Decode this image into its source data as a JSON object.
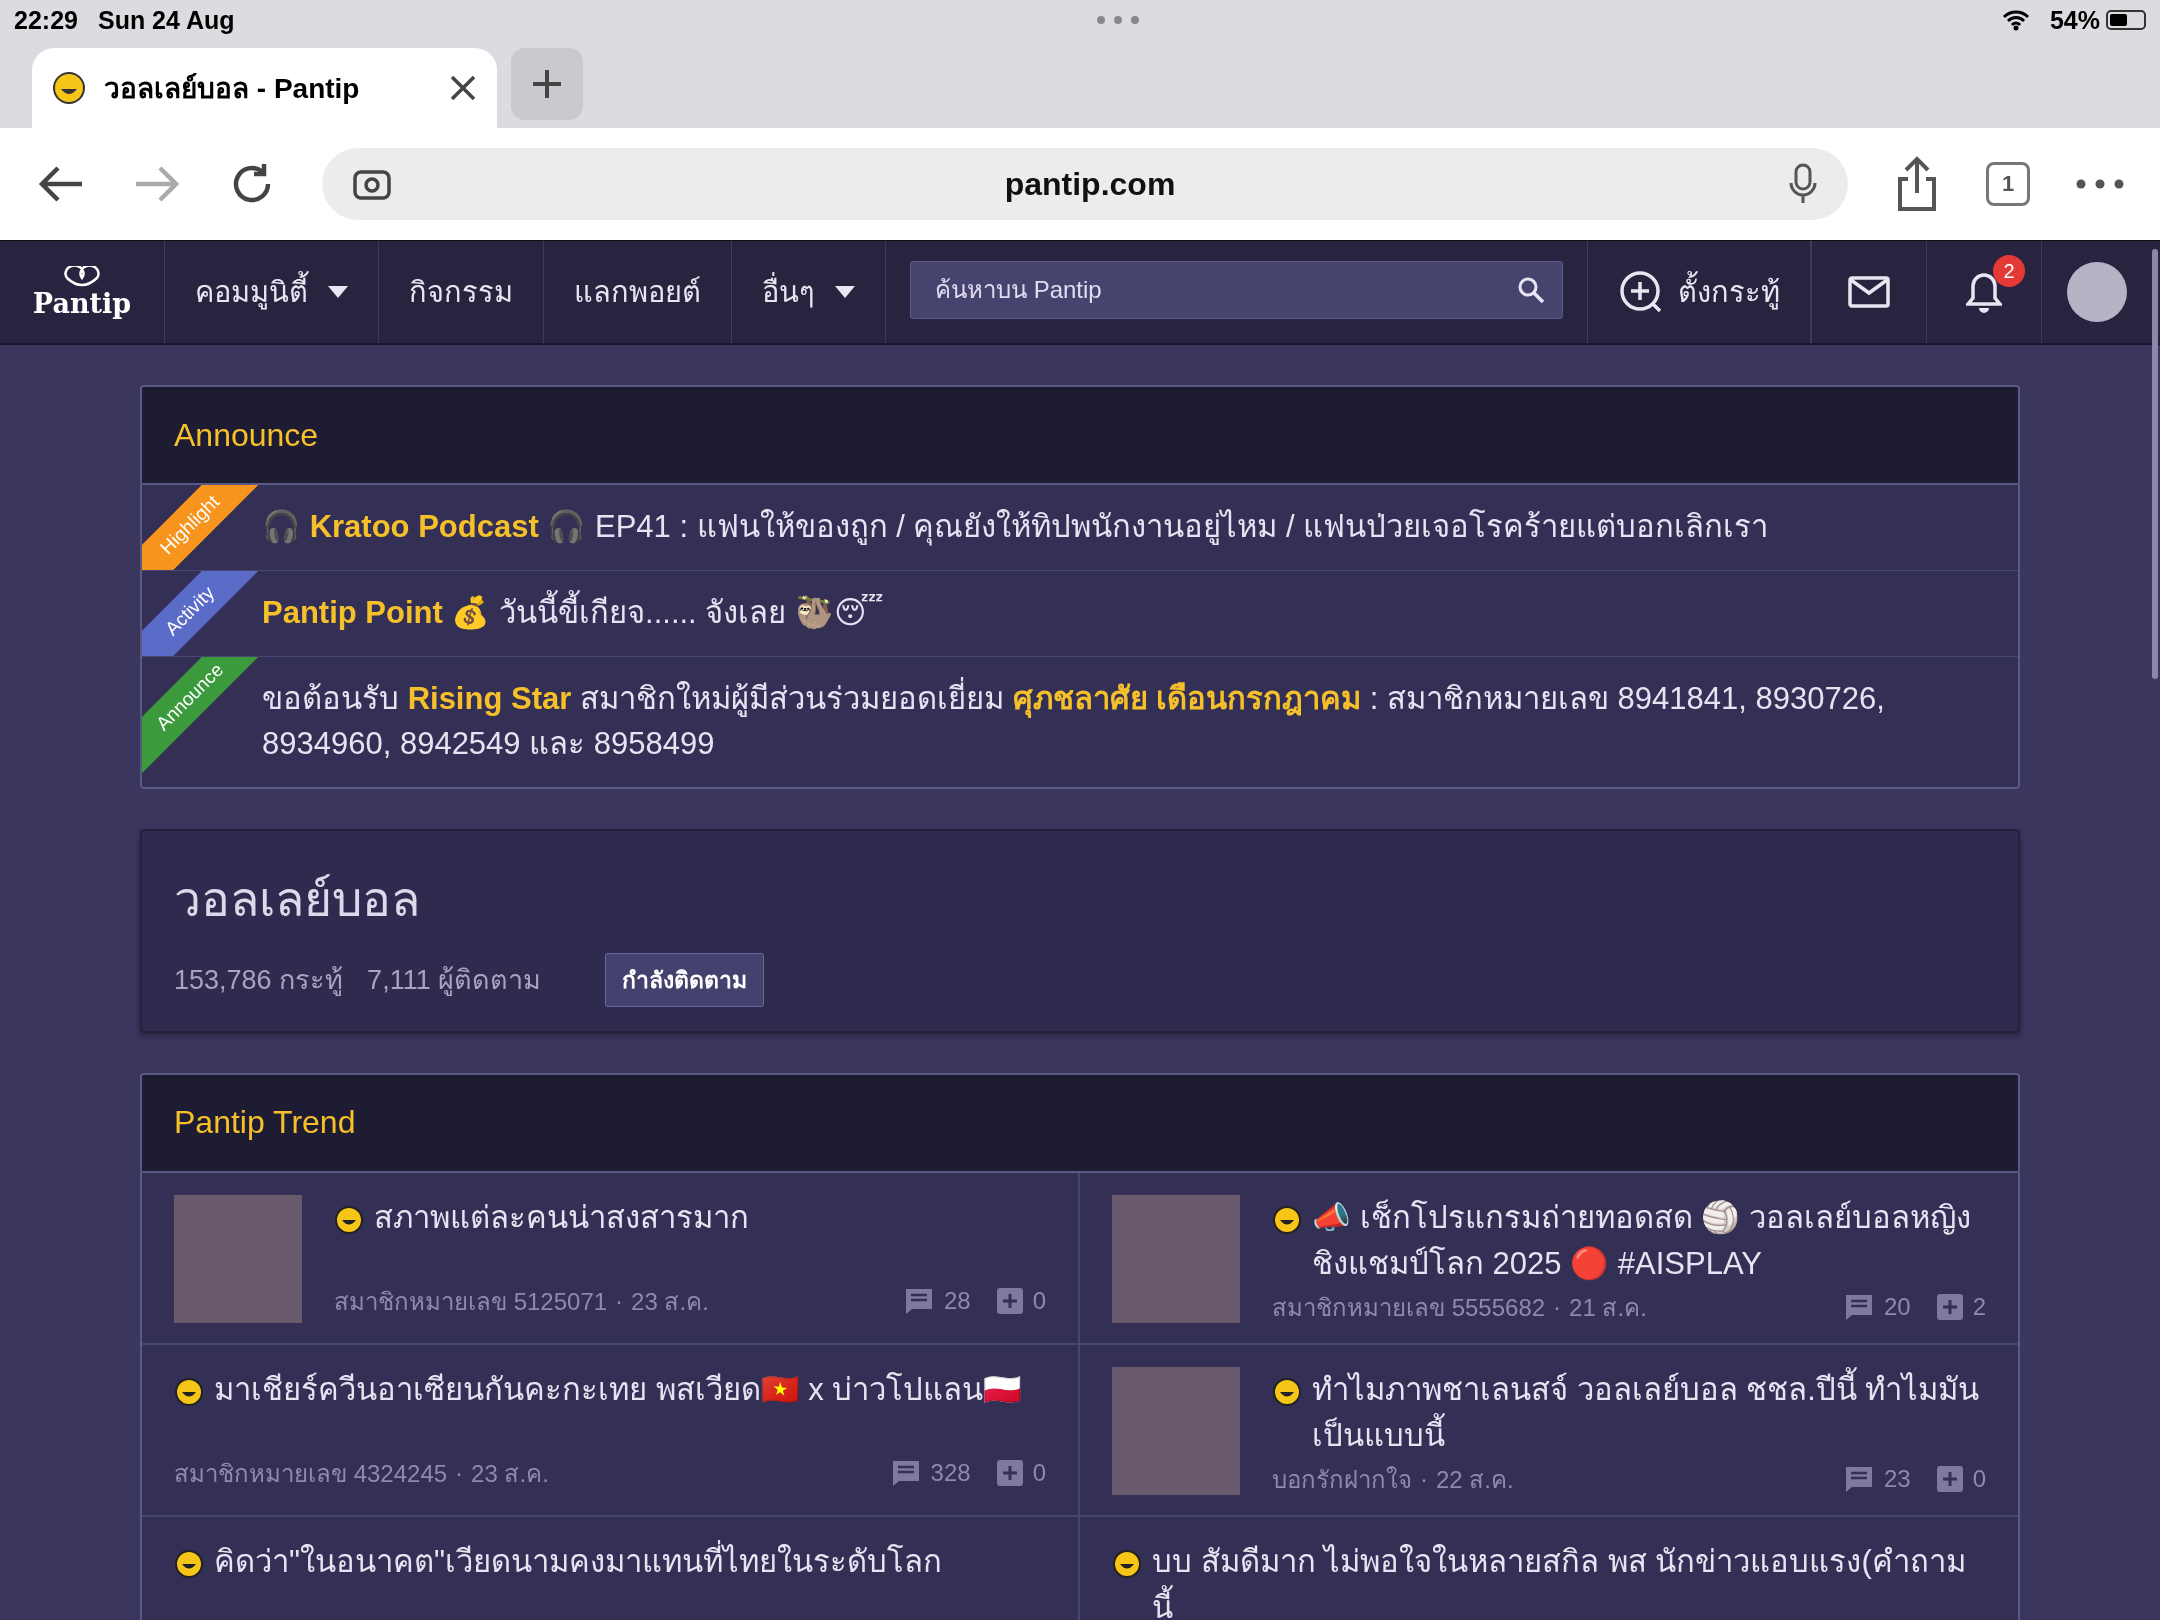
{
  "status_bar": {
    "time": "22:29",
    "date": "Sun 24 Aug",
    "battery_text": "54%",
    "battery": {
      "level": 0.54
    }
  },
  "browser": {
    "tab_title": "วอลเลย์บอล - Pantip",
    "url": "pantip.com",
    "tab_count": "1"
  },
  "nav": {
    "logo": "Pantip",
    "items": [
      {
        "label": "คอมมูนิตี้",
        "dropdown": true
      },
      {
        "label": "กิจกรรม",
        "dropdown": false
      },
      {
        "label": "แลกพอยต์",
        "dropdown": false
      },
      {
        "label": "อื่นๆ",
        "dropdown": true
      }
    ],
    "search": {
      "placeholder": "ค้นหาบน Pantip"
    },
    "new_topic": "ตั้งกระทู้",
    "notification_count": "2"
  },
  "announce": {
    "title": "Announce",
    "items": [
      {
        "ribbon": "Highlight",
        "color": "#f7941d",
        "text": "🎧 **Kratoo Podcast** 🎧 EP41 : แฟนให้ของถูก / คุณยังให้ทิปพนักงานอยู่ไหม / แฟนป่วยเจอโรคร้ายแต่บอกเลิกเรา"
      },
      {
        "ribbon": "Activity",
        "color": "#5b6bc8",
        "text": "**Pantip Point** 💰 วันนี้ขี้เกียจ...... จังเลย 🦥😴"
      },
      {
        "ribbon": "Announce",
        "color": "#3a9a3c",
        "text": "ขอต้อนรับ **Rising Star** สมาชิกใหม่ผู้มีส่วนร่วมยอดเยี่ยม **ศุภชลาศัย เดือนกรกฎาคม** : สมาชิกหมายเลข 8941841, 8930726, 8934960, 8942549 และ 8958499"
      }
    ]
  },
  "board": {
    "title": "วอลเลย์บอล",
    "topics": "153,786 กระทู้",
    "followers": "7,111 ผู้ติดตาม",
    "follow_button": "กำลังติดตาม"
  },
  "trend": {
    "title": "Pantip Trend",
    "items": [
      {
        "thumbnail": true,
        "title": "สภาพแต่ละคนน่าสงสารมาก",
        "author": "สมาชิกหมายเลข 5125071",
        "separator": "·",
        "date": "23 ส.ค.",
        "comments": "28",
        "votes": "0"
      },
      {
        "thumbnail": true,
        "title": "📣 เช็กโปรแกรมถ่ายทอดสด 🏐 วอลเลย์บอลหญิงชิงแชมป์โลก 2025 🔴 #AISPLAY",
        "author": "สมาชิกหมายเลข 5555682",
        "separator": "·",
        "date": "21 ส.ค.",
        "comments": "20",
        "votes": "2"
      },
      {
        "thumbnail": false,
        "title": "มาเชียร์ควีนอาเซียนกันคะกะเทย พสเวียด🇻🇳 x บ่าวโปแลน🇵🇱",
        "author": "สมาชิกหมายเลข 4324245",
        "separator": "·",
        "date": "23 ส.ค.",
        "comments": "328",
        "votes": "0"
      },
      {
        "thumbnail": true,
        "title": "ทำไมภาพชาเลนสจ์ วอลเลย์บอล ชชล.ปีนี้ ทำไมมันเป็นแบบนี้",
        "author": "บอกรักฝากใจ",
        "separator": "·",
        "date": "22 ส.ค.",
        "comments": "23",
        "votes": "0"
      },
      {
        "thumbnail": false,
        "title": "คิดว่า\"ในอนาคต\"เวียดนามคงมาแทนที่ไทยในระดับโลก"
      },
      {
        "thumbnail": false,
        "title": "บบ สัมดีมาก ไม่พอใจในหลายสกิล พส นักข่าวแอบแรง(คำถามนี้"
      }
    ]
  }
}
